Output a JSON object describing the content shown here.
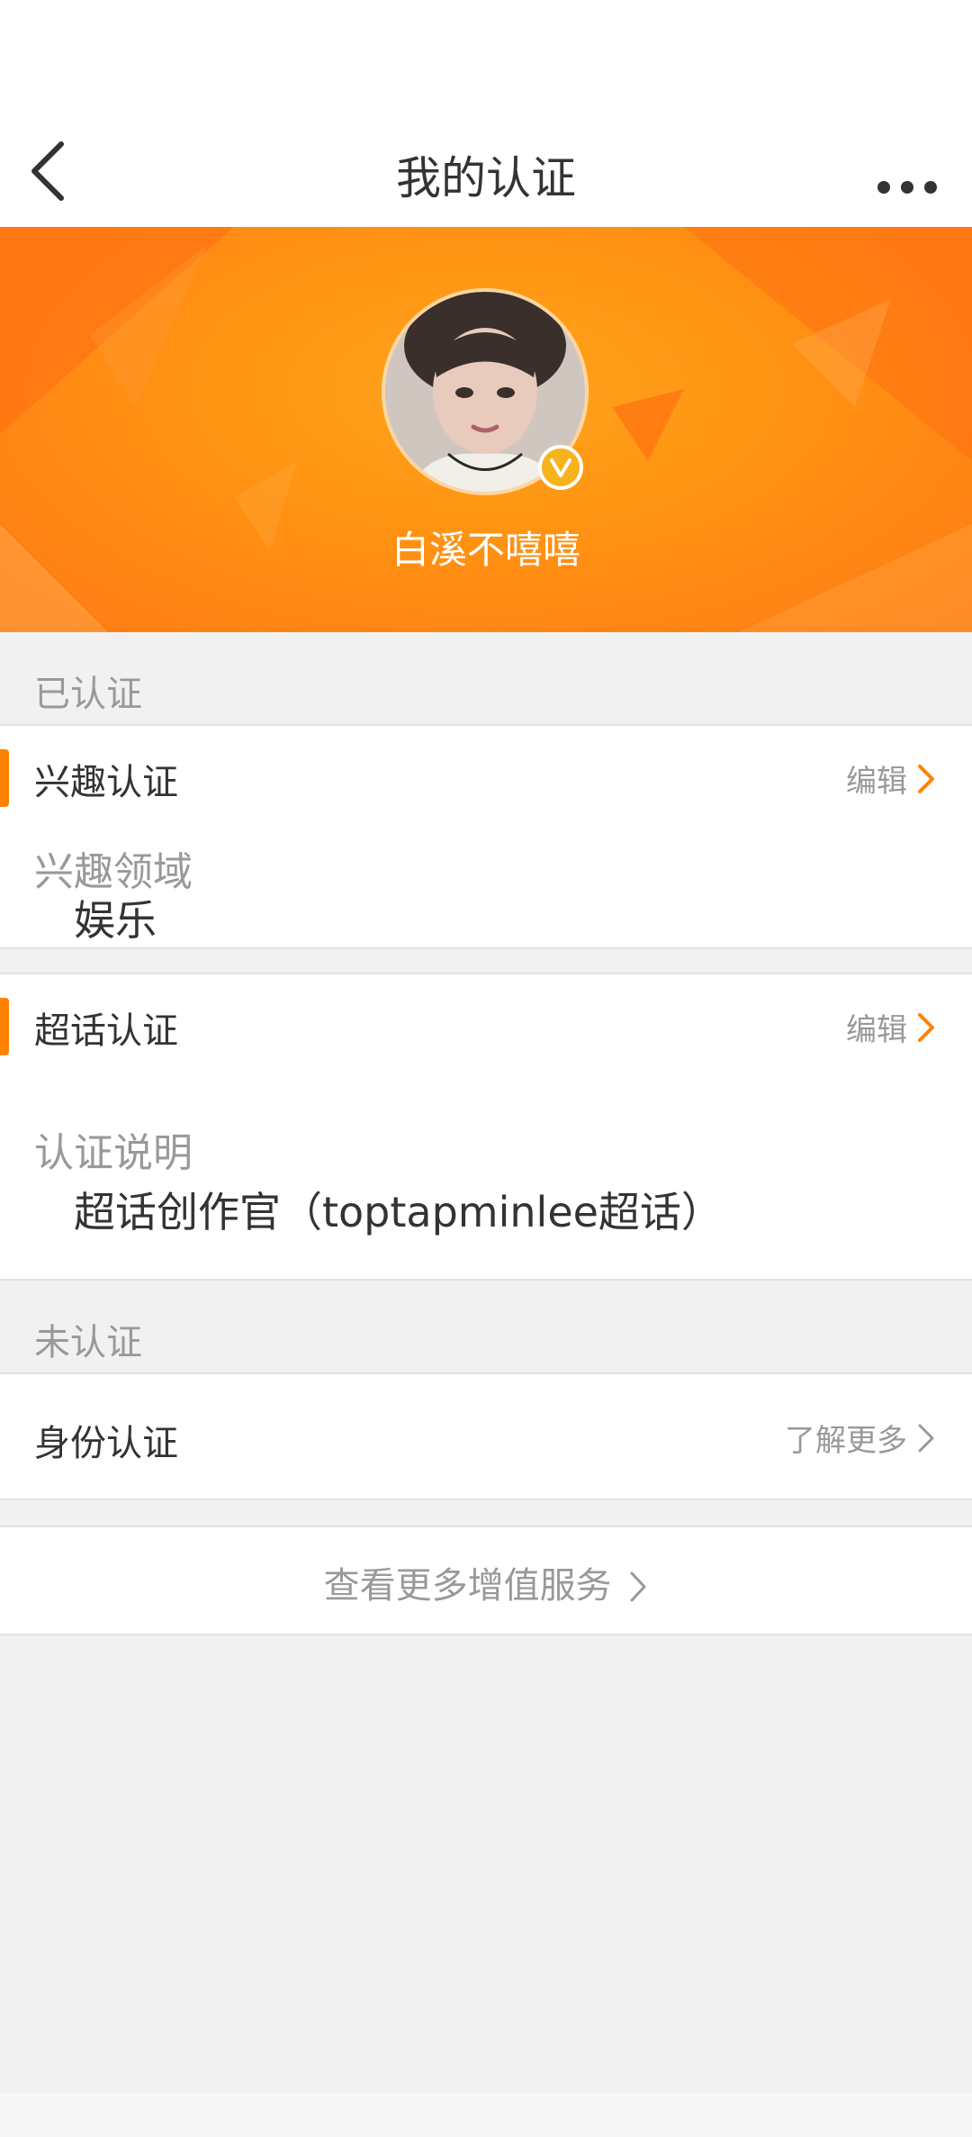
{
  "header": {
    "title": "我的认证"
  },
  "profile": {
    "username": "白溪不嘻嘻",
    "badge_letter": "V"
  },
  "verified_section": {
    "title": "已认证",
    "interest": {
      "label": "兴趣认证",
      "action": "编辑",
      "field_label": "兴趣领域",
      "field_value": "娱乐"
    },
    "super_topic": {
      "label": "超话认证",
      "action": "编辑",
      "field_label": "认证说明",
      "field_value": "超话创作官（toptapminlee超话）"
    }
  },
  "unverified_section": {
    "title": "未认证",
    "identity": {
      "label": "身份认证",
      "action": "了解更多"
    }
  },
  "more_services": {
    "label": "查看更多增值服务"
  },
  "colors": {
    "accent": "#ff8200",
    "banner": "#ff9412",
    "badge": "#f6b31b"
  },
  "icons": {
    "back": "chevron-left-icon",
    "more": "more-dots-icon",
    "row_arrow": "chevron-right-icon",
    "verified": "verified-v-icon"
  }
}
